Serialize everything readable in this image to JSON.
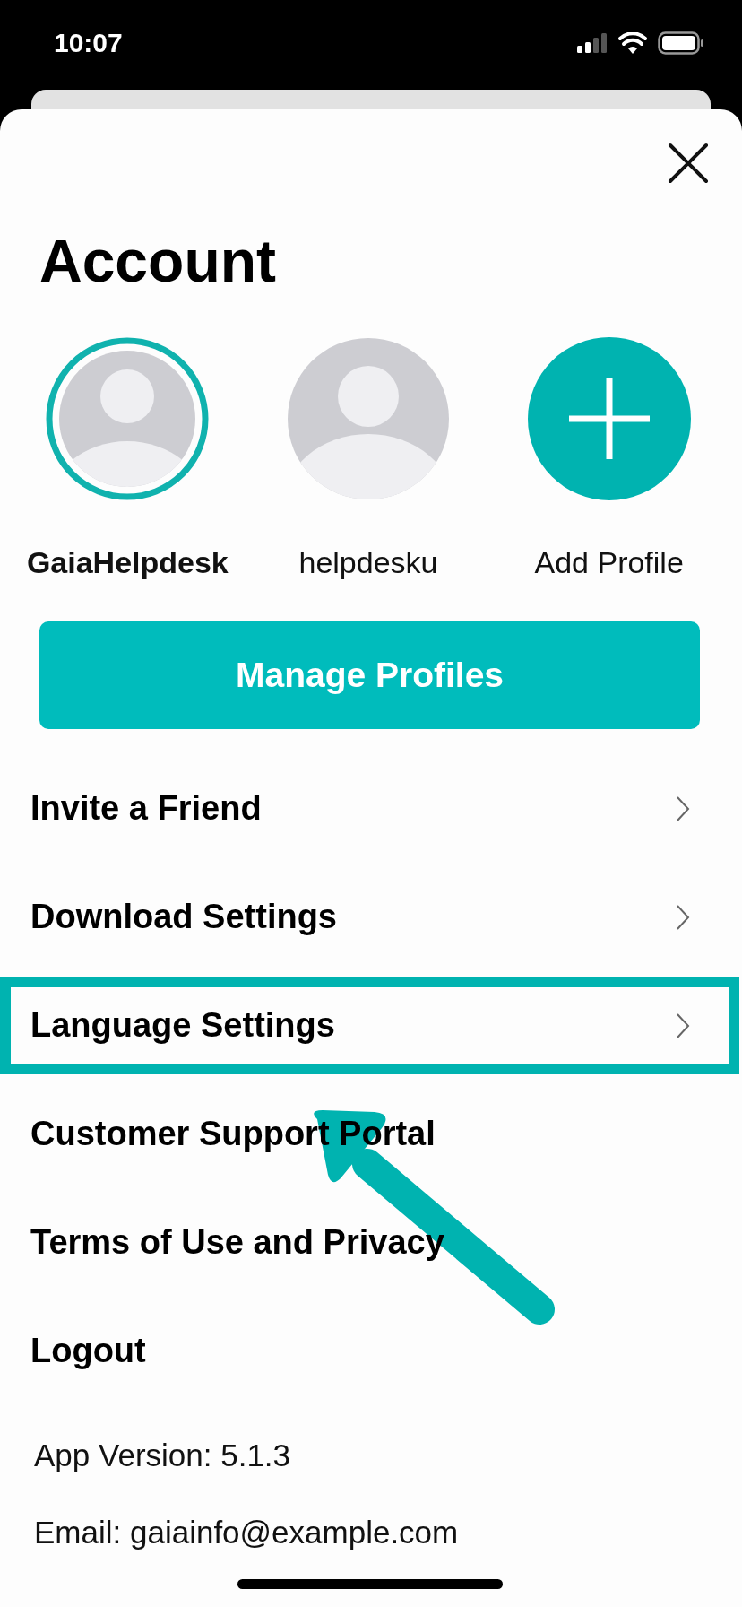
{
  "status_bar": {
    "time": "10:07"
  },
  "title": "Account",
  "profiles": [
    {
      "kind": "profile",
      "name": "GaiaHelpdesk",
      "selected": true
    },
    {
      "kind": "profile",
      "name": "helpdesku",
      "selected": false
    },
    {
      "kind": "add",
      "name": "Add Profile",
      "selected": false
    }
  ],
  "manage_button": "Manage Profiles",
  "menu": [
    {
      "label": "Invite a Friend",
      "chevron": true,
      "highlighted": false
    },
    {
      "label": "Download Settings",
      "chevron": true,
      "highlighted": false
    },
    {
      "label": "Language Settings",
      "chevron": true,
      "highlighted": true
    },
    {
      "label": "Customer Support Portal",
      "chevron": false,
      "highlighted": false
    },
    {
      "label": "Terms of Use and Privacy",
      "chevron": false,
      "highlighted": false
    },
    {
      "label": "Logout",
      "chevron": false,
      "highlighted": false
    }
  ],
  "info": [
    "App Version: 5.1.3",
    "Email: gaiainfo@example.com"
  ]
}
